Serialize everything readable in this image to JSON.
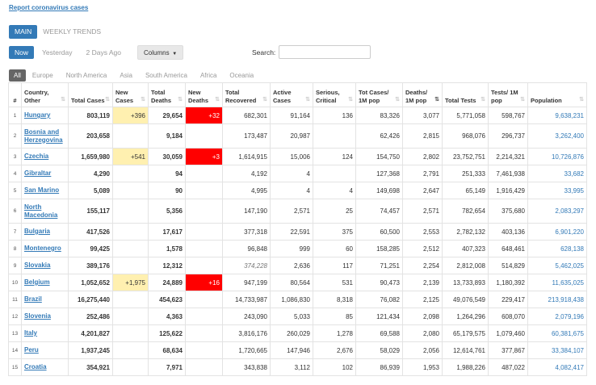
{
  "report_link": "Report coronavirus cases",
  "main_tabs": [
    {
      "label": "MAIN",
      "active": true
    },
    {
      "label": "WEEKLY TRENDS",
      "active": false
    }
  ],
  "day_tabs": [
    {
      "label": "Now",
      "active": true
    },
    {
      "label": "Yesterday",
      "active": false
    },
    {
      "label": "2 Days Ago",
      "active": false
    }
  ],
  "columns_button": "Columns",
  "search": {
    "label": "Search:",
    "value": ""
  },
  "region_tabs": [
    {
      "label": "All",
      "active": true
    },
    {
      "label": "Europe",
      "active": false
    },
    {
      "label": "North America",
      "active": false
    },
    {
      "label": "Asia",
      "active": false
    },
    {
      "label": "South America",
      "active": false
    },
    {
      "label": "Africa",
      "active": false
    },
    {
      "label": "Oceania",
      "active": false
    }
  ],
  "table": {
    "headers": [
      "#",
      "Country, Other",
      "Total Cases",
      "New Cases",
      "Total Deaths",
      "New Deaths",
      "Total Recovered",
      "Active Cases",
      "Serious, Critical",
      "Tot Cases/ 1M pop",
      "Deaths/ 1M pop",
      "Total Tests",
      "Tests/ 1M pop",
      "Population"
    ],
    "rows": [
      {
        "num": "1",
        "country": "Hungary",
        "total_cases": "803,119",
        "new_cases": "+396",
        "total_deaths": "29,654",
        "new_deaths": "+32",
        "total_recovered": "682,301",
        "active_cases": "91,164",
        "serious": "136",
        "cases_1m": "83,326",
        "deaths_1m": "3,077",
        "total_tests": "5,771,058",
        "tests_1m": "598,767",
        "population": "9,638,231"
      },
      {
        "num": "2",
        "country": "Bosnia and Herzegovina",
        "total_cases": "203,658",
        "new_cases": "",
        "total_deaths": "9,184",
        "new_deaths": "",
        "total_recovered": "173,487",
        "active_cases": "20,987",
        "serious": "",
        "cases_1m": "62,426",
        "deaths_1m": "2,815",
        "total_tests": "968,076",
        "tests_1m": "296,737",
        "population": "3,262,400"
      },
      {
        "num": "3",
        "country": "Czechia",
        "total_cases": "1,659,980",
        "new_cases": "+541",
        "total_deaths": "30,059",
        "new_deaths": "+3",
        "total_recovered": "1,614,915",
        "active_cases": "15,006",
        "serious": "124",
        "cases_1m": "154,750",
        "deaths_1m": "2,802",
        "total_tests": "23,752,751",
        "tests_1m": "2,214,321",
        "population": "10,726,876"
      },
      {
        "num": "4",
        "country": "Gibraltar",
        "total_cases": "4,290",
        "new_cases": "",
        "total_deaths": "94",
        "new_deaths": "",
        "total_recovered": "4,192",
        "active_cases": "4",
        "serious": "",
        "cases_1m": "127,368",
        "deaths_1m": "2,791",
        "total_tests": "251,333",
        "tests_1m": "7,461,938",
        "population": "33,682"
      },
      {
        "num": "5",
        "country": "San Marino",
        "total_cases": "5,089",
        "new_cases": "",
        "total_deaths": "90",
        "new_deaths": "",
        "total_recovered": "4,995",
        "active_cases": "4",
        "serious": "4",
        "cases_1m": "149,698",
        "deaths_1m": "2,647",
        "total_tests": "65,149",
        "tests_1m": "1,916,429",
        "population": "33,995"
      },
      {
        "num": "6",
        "country": "North Macedonia",
        "total_cases": "155,117",
        "new_cases": "",
        "total_deaths": "5,356",
        "new_deaths": "",
        "total_recovered": "147,190",
        "active_cases": "2,571",
        "serious": "25",
        "cases_1m": "74,457",
        "deaths_1m": "2,571",
        "total_tests": "782,654",
        "tests_1m": "375,680",
        "population": "2,083,297"
      },
      {
        "num": "7",
        "country": "Bulgaria",
        "total_cases": "417,526",
        "new_cases": "",
        "total_deaths": "17,617",
        "new_deaths": "",
        "total_recovered": "377,318",
        "active_cases": "22,591",
        "serious": "375",
        "cases_1m": "60,500",
        "deaths_1m": "2,553",
        "total_tests": "2,782,132",
        "tests_1m": "403,136",
        "population": "6,901,220"
      },
      {
        "num": "8",
        "country": "Montenegro",
        "total_cases": "99,425",
        "new_cases": "",
        "total_deaths": "1,578",
        "new_deaths": "",
        "total_recovered": "96,848",
        "active_cases": "999",
        "serious": "60",
        "cases_1m": "158,285",
        "deaths_1m": "2,512",
        "total_tests": "407,323",
        "tests_1m": "648,461",
        "population": "628,138"
      },
      {
        "num": "9",
        "country": "Slovakia",
        "total_cases": "389,176",
        "new_cases": "",
        "total_deaths": "12,312",
        "new_deaths": "",
        "total_recovered": "374,228",
        "active_cases": "2,636",
        "serious": "117",
        "cases_1m": "71,251",
        "deaths_1m": "2,254",
        "total_tests": "2,812,008",
        "tests_1m": "514,829",
        "population": "5,462,025"
      },
      {
        "num": "10",
        "country": "Belgium",
        "total_cases": "1,052,652",
        "new_cases": "+1,975",
        "total_deaths": "24,889",
        "new_deaths": "+16",
        "total_recovered": "947,199",
        "active_cases": "80,564",
        "serious": "531",
        "cases_1m": "90,473",
        "deaths_1m": "2,139",
        "total_tests": "13,733,893",
        "tests_1m": "1,180,392",
        "population": "11,635,025"
      },
      {
        "num": "11",
        "country": "Brazil",
        "total_cases": "16,275,440",
        "new_cases": "",
        "total_deaths": "454,623",
        "new_deaths": "",
        "total_recovered": "14,733,987",
        "active_cases": "1,086,830",
        "serious": "8,318",
        "cases_1m": "76,082",
        "deaths_1m": "2,125",
        "total_tests": "49,076,549",
        "tests_1m": "229,417",
        "population": "213,918,438"
      },
      {
        "num": "12",
        "country": "Slovenia",
        "total_cases": "252,486",
        "new_cases": "",
        "total_deaths": "4,363",
        "new_deaths": "",
        "total_recovered": "243,090",
        "active_cases": "5,033",
        "serious": "85",
        "cases_1m": "121,434",
        "deaths_1m": "2,098",
        "total_tests": "1,264,296",
        "tests_1m": "608,070",
        "population": "2,079,196"
      },
      {
        "num": "13",
        "country": "Italy",
        "total_cases": "4,201,827",
        "new_cases": "",
        "total_deaths": "125,622",
        "new_deaths": "",
        "total_recovered": "3,816,176",
        "active_cases": "260,029",
        "serious": "1,278",
        "cases_1m": "69,588",
        "deaths_1m": "2,080",
        "total_tests": "65,179,575",
        "tests_1m": "1,079,460",
        "population": "60,381,675"
      },
      {
        "num": "14",
        "country": "Peru",
        "total_cases": "1,937,245",
        "new_cases": "",
        "total_deaths": "68,634",
        "new_deaths": "",
        "total_recovered": "1,720,665",
        "active_cases": "147,946",
        "serious": "2,676",
        "cases_1m": "58,029",
        "deaths_1m": "2,056",
        "total_tests": "12,614,761",
        "tests_1m": "377,867",
        "population": "33,384,107"
      },
      {
        "num": "15",
        "country": "Croatia",
        "total_cases": "354,921",
        "new_cases": "",
        "total_deaths": "7,971",
        "new_deaths": "",
        "total_recovered": "343,838",
        "active_cases": "3,112",
        "serious": "102",
        "cases_1m": "86,939",
        "deaths_1m": "1,953",
        "total_tests": "1,988,226",
        "tests_1m": "487,022",
        "population": "4,082,417"
      }
    ]
  },
  "colors": {
    "accent": "#337ab7",
    "new_cases_bg": "#fff0b0",
    "new_deaths_bg": "#ff0000"
  }
}
